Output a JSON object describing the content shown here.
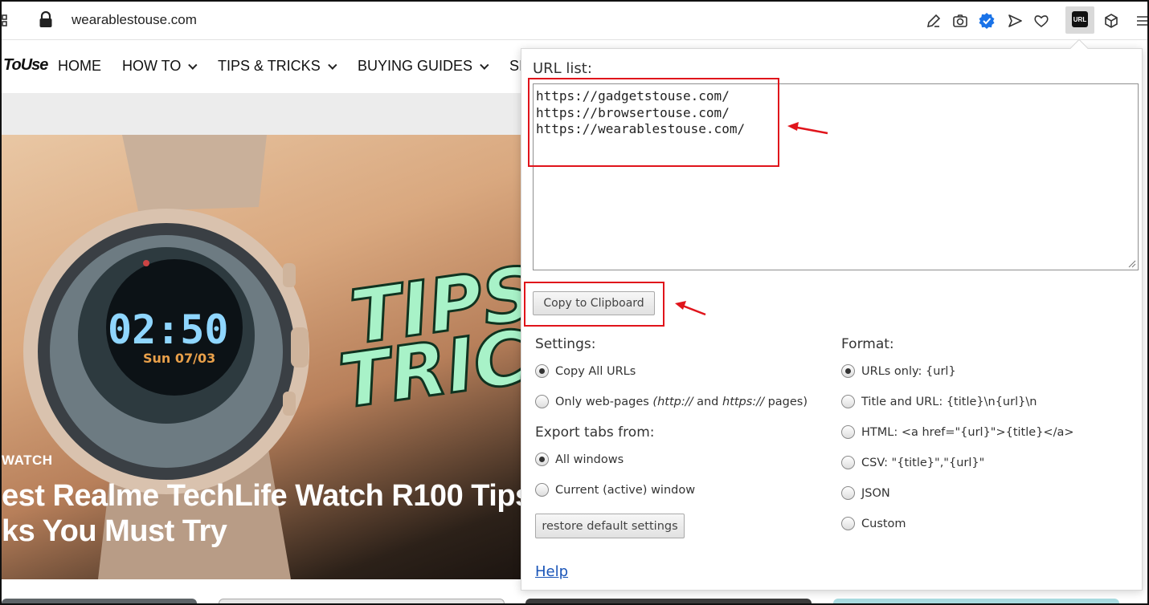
{
  "browser": {
    "address": "wearablestouse.com",
    "toolbar_icons": [
      "edit-icon",
      "camera-icon",
      "shield-check-icon",
      "send-icon",
      "heart-icon",
      "url-list-extension-icon",
      "cube-icon",
      "menu-icon"
    ],
    "extension_badge": "URL",
    "accent_color": "#1a73e8"
  },
  "site": {
    "logo": "ToUse",
    "nav": [
      "HOME",
      "HOW TO",
      "TIPS & TRICKS",
      "BUYING GUIDES",
      "SI"
    ],
    "hero": {
      "category": "WATCH",
      "title_line1": "est Realme TechLife Watch R100 Tips",
      "title_line2": "ks You Must Try",
      "watch_time": "02:50",
      "watch_date": "Sun 07/03",
      "graphic_word1": "TIPS &",
      "graphic_word2": "TRICKS"
    }
  },
  "popup": {
    "url_label": "URL list:",
    "url_text": "https://gadgetstouse.com/\nhttps://browsertouse.com/\nhttps://wearablestouse.com/",
    "copy_button": "Copy to Clipboard",
    "settings": {
      "title": "Settings:",
      "options": [
        {
          "label": "Copy All URLs",
          "checked": true
        },
        {
          "label_prefix": "Only web-pages ",
          "label_em1": "(http://",
          "label_mid": " and ",
          "label_em2": "https://",
          "label_suffix": " pages)",
          "checked": false
        }
      ]
    },
    "export": {
      "title": "Export tabs from:",
      "options": [
        {
          "label": "All windows",
          "checked": true
        },
        {
          "label": "Current (active) window",
          "checked": false
        }
      ]
    },
    "format": {
      "title": "Format:",
      "options": [
        {
          "label": "URLs only: {url}",
          "checked": true
        },
        {
          "label": "Title and URL: {title}\\n{url}\\n",
          "checked": false
        },
        {
          "label": "HTML: <a href=\"{url}\">{title}</a>",
          "checked": false
        },
        {
          "label": "CSV: \"{title}\",\"{url}\"",
          "checked": false
        },
        {
          "label": "JSON",
          "checked": false
        },
        {
          "label": "Custom",
          "checked": false
        }
      ]
    },
    "restore_button": "restore default settings",
    "help_link": "Help"
  },
  "annotation_color": "#e0141b"
}
